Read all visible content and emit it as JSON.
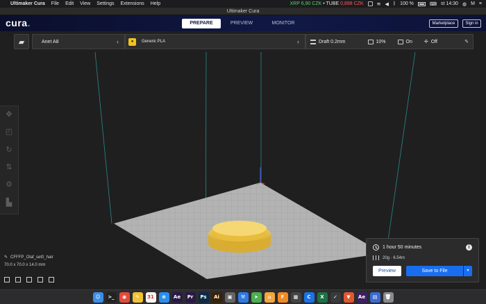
{
  "menubar": {
    "apple_glyph": "",
    "app_name": "Ultimaker Cura",
    "items": [
      "File",
      "Edit",
      "View",
      "Settings",
      "Extensions",
      "Help"
    ],
    "ticker_xrp": "XRP 6,90 CZK",
    "ticker_separator": "•",
    "ticker_tube_label": "TUBE",
    "ticker_tube_value": "0,898 CZK",
    "battery_percent": "100 %",
    "clock": "st 14:30"
  },
  "window": {
    "title": "Ultimaker Cura"
  },
  "header": {
    "logo": "cura",
    "logo_dot": ".",
    "tabs": [
      {
        "label": "PREPARE",
        "active": true
      },
      {
        "label": "PREVIEW",
        "active": false
      },
      {
        "label": "MONITOR",
        "active": false
      }
    ],
    "marketplace_label": "Marketplace",
    "signin_label": "Sign in"
  },
  "settings_bar": {
    "printer": "Anet A8",
    "material": "Generic PLA",
    "profile": "Draft 0.2mm",
    "infill": "10%",
    "support": "On",
    "adhesion": "Off"
  },
  "object_info": {
    "name": "CFFFP_Olaf_set0_hair",
    "dimensions": "70.0 x 70.0 x 14.0 mm"
  },
  "action_panel": {
    "print_time": "1 hour 50 minutes",
    "material_usage": "20g · 6.54m",
    "preview_label": "Preview",
    "save_label": "Save to File"
  },
  "dock": {
    "icons": [
      {
        "name": "finder-icon",
        "glyph": "☺",
        "color": "#3b8ee6"
      },
      {
        "name": "terminal-icon",
        "glyph": ">_",
        "color": "#222222"
      },
      {
        "name": "chrome-icon",
        "glyph": "◉",
        "color": "#e34b3b"
      },
      {
        "name": "notes-icon",
        "glyph": "✎",
        "color": "#f1c232"
      },
      {
        "name": "calendar-icon",
        "glyph": "31",
        "color": "#f5f5f5"
      },
      {
        "name": "safari-icon",
        "glyph": "⊕",
        "color": "#2a8ef0"
      },
      {
        "name": "after-effects-icon",
        "glyph": "Ae",
        "color": "#2a1947"
      },
      {
        "name": "premiere-icon",
        "glyph": "Pr",
        "color": "#2a1947"
      },
      {
        "name": "photoshop-icon",
        "glyph": "Ps",
        "color": "#0d2a48"
      },
      {
        "name": "illustrator-icon",
        "glyph": "Ai",
        "color": "#3b2200"
      },
      {
        "name": "camera-icon",
        "glyph": "▣",
        "color": "#666666"
      },
      {
        "name": "xcode-icon",
        "glyph": "⚒",
        "color": "#2f7ae5"
      },
      {
        "name": "maps-icon",
        "glyph": "➤",
        "color": "#4caf50"
      },
      {
        "name": "home-icon",
        "glyph": "⌂",
        "color": "#f2a73b"
      },
      {
        "name": "fontforge-icon",
        "glyph": "F",
        "color": "#f08a24"
      },
      {
        "name": "app-icon",
        "glyph": "▦",
        "color": "#444444"
      },
      {
        "name": "cura-icon",
        "glyph": "C",
        "color": "#1a73e8"
      },
      {
        "name": "excel-icon",
        "glyph": "X",
        "color": "#1e7145"
      },
      {
        "name": "teams-icon",
        "glyph": "✓",
        "color": "#3a3a3a"
      },
      {
        "name": "brave-icon",
        "glyph": "▼",
        "color": "#e2572e"
      },
      {
        "name": "media-encoder-icon",
        "glyph": "Ae",
        "color": "#3e1f66"
      },
      {
        "name": "downloads-icon",
        "glyph": "▤",
        "color": "#3a6bd0"
      },
      {
        "name": "trash-icon",
        "glyph": "🗑",
        "color": "#8a8a8a"
      }
    ]
  }
}
